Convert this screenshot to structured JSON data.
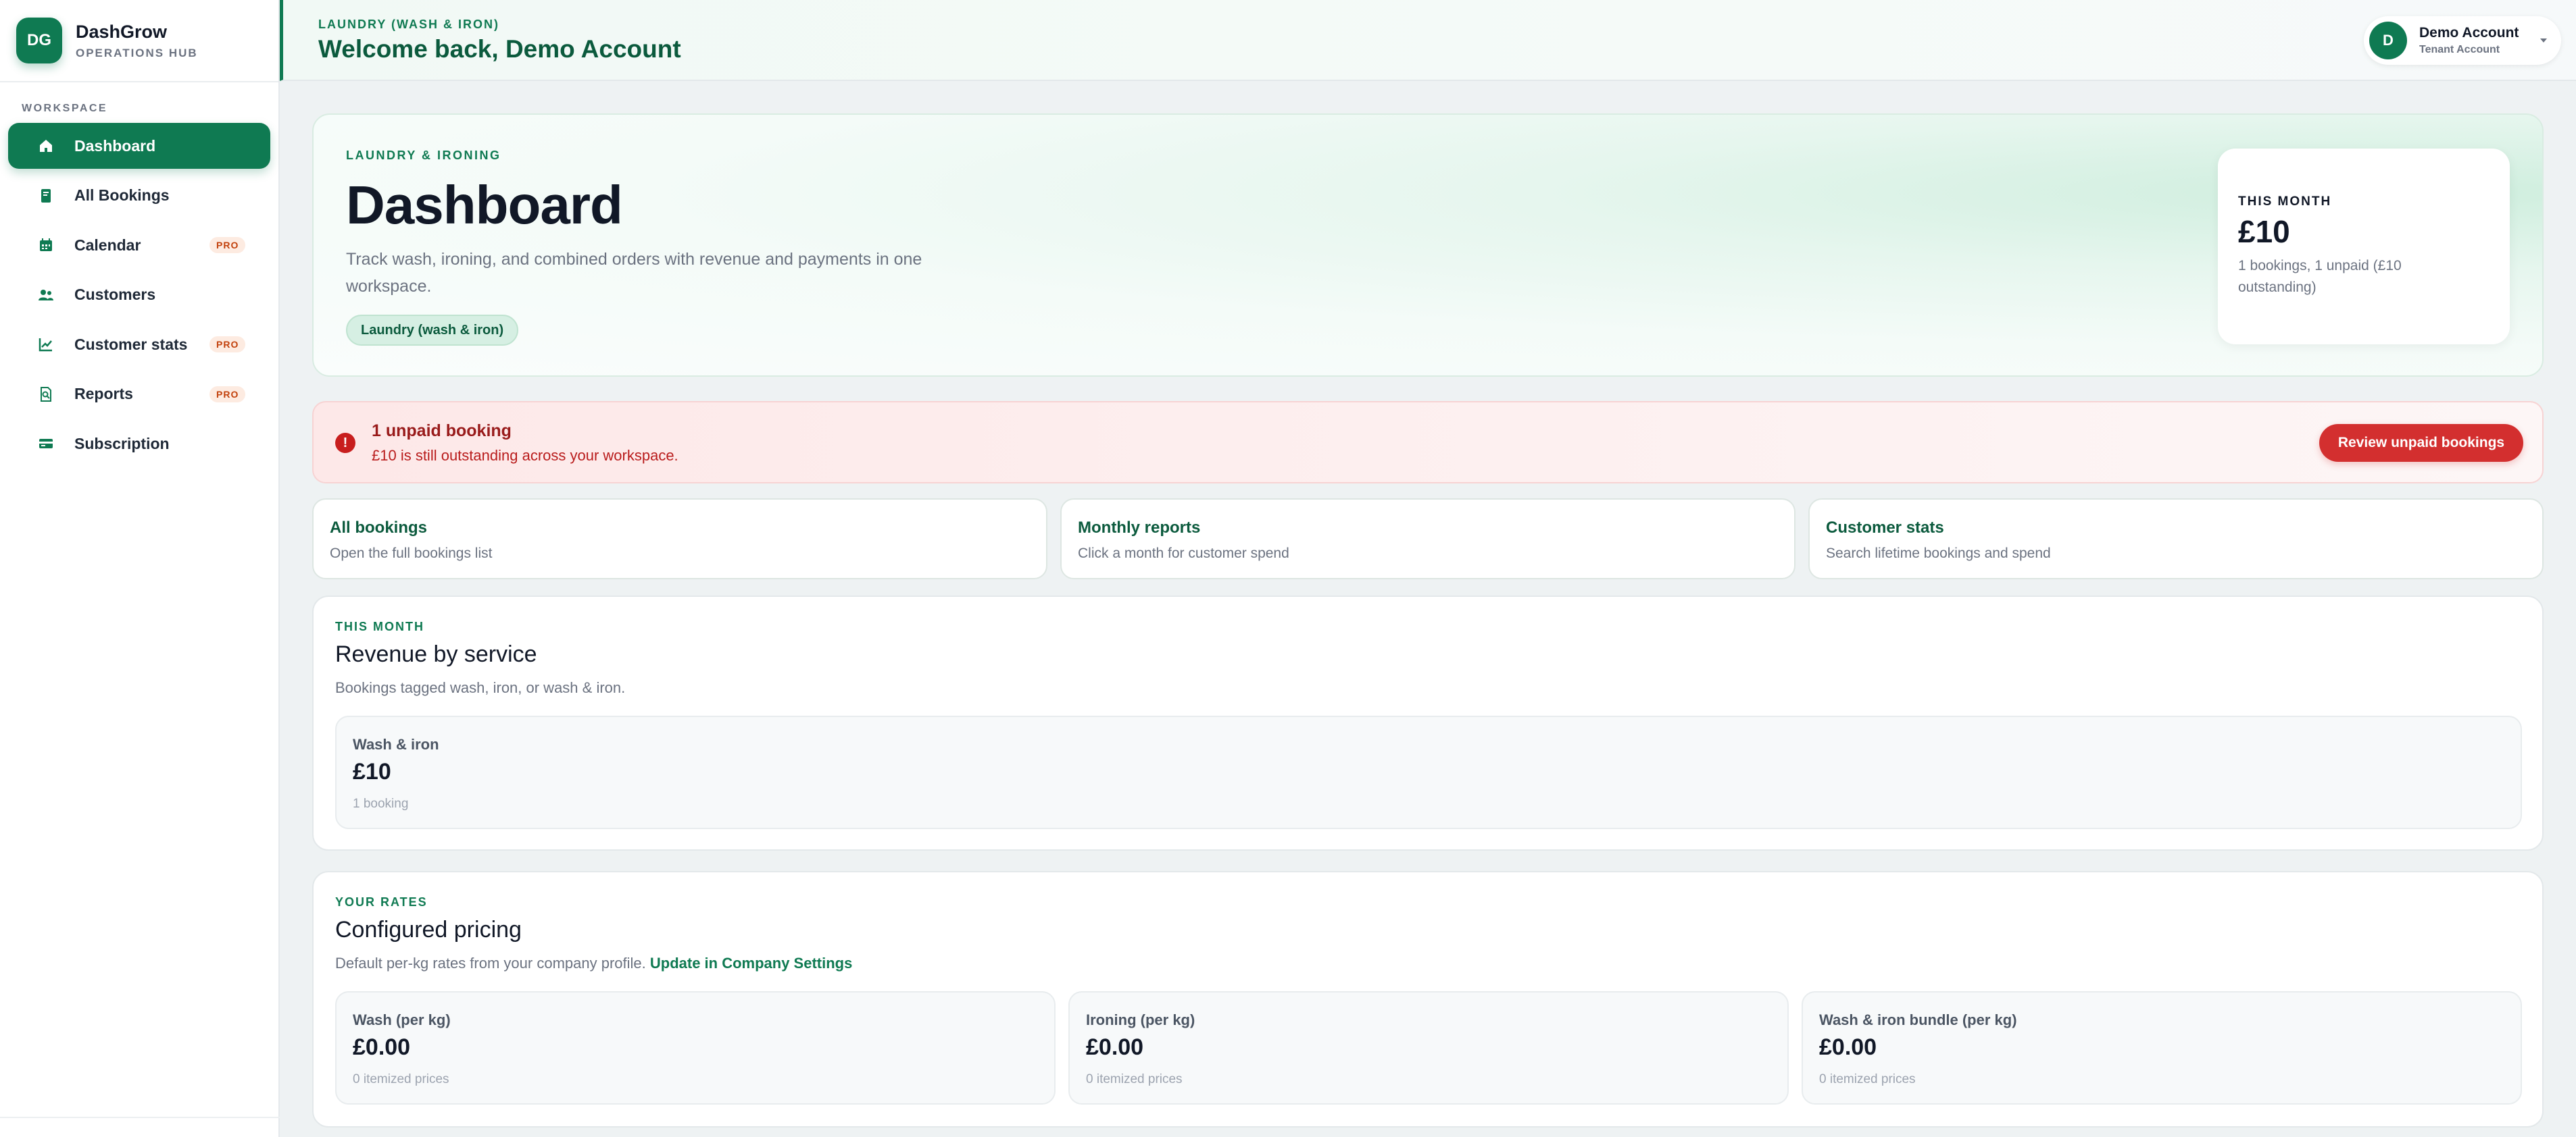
{
  "brand": {
    "logo": "DG",
    "name": "DashGrow",
    "subtitle": "OPERATIONS HUB"
  },
  "sidebar": {
    "section_label": "WORKSPACE",
    "items": [
      {
        "label": "Dashboard",
        "icon": "home-icon",
        "active": true,
        "badge": ""
      },
      {
        "label": "All Bookings",
        "icon": "book-icon",
        "active": false,
        "badge": ""
      },
      {
        "label": "Calendar",
        "icon": "calendar-icon",
        "active": false,
        "badge": "PRO"
      },
      {
        "label": "Customers",
        "icon": "users-icon",
        "active": false,
        "badge": ""
      },
      {
        "label": "Customer stats",
        "icon": "chart-line-icon",
        "active": false,
        "badge": "PRO"
      },
      {
        "label": "Reports",
        "icon": "report-search-icon",
        "active": false,
        "badge": "PRO"
      },
      {
        "label": "Subscription",
        "icon": "credit-card-icon",
        "active": false,
        "badge": ""
      }
    ]
  },
  "header": {
    "kicker": "LAUNDRY (WASH & IRON)",
    "title": "Welcome back, Demo Account",
    "account": {
      "avatar": "D",
      "name": "Demo Account",
      "role": "Tenant Account"
    }
  },
  "hero": {
    "kicker": "LAUNDRY & IRONING",
    "title": "Dashboard",
    "description": "Track wash, ironing, and combined orders with revenue and payments in one workspace.",
    "tag": "Laundry (wash & iron)",
    "month": {
      "kicker": "THIS MONTH",
      "value": "£10",
      "description": "1 bookings, 1 unpaid (£10 outstanding)"
    }
  },
  "alert": {
    "icon": "!",
    "title": "1 unpaid booking",
    "description": "£10 is still outstanding across your workspace.",
    "button": "Review unpaid bookings"
  },
  "quick_links": [
    {
      "title": "All bookings",
      "description": "Open the full bookings list"
    },
    {
      "title": "Monthly reports",
      "description": "Click a month for customer spend"
    },
    {
      "title": "Customer stats",
      "description": "Search lifetime bookings and spend"
    }
  ],
  "revenue": {
    "kicker": "THIS MONTH",
    "title": "Revenue by service",
    "description": "Bookings tagged wash, iron, or wash & iron.",
    "items": [
      {
        "label": "Wash & iron",
        "value": "£10",
        "sub": "1 booking"
      }
    ]
  },
  "pricing": {
    "kicker": "YOUR RATES",
    "title": "Configured pricing",
    "description": "Default per-kg rates from your company profile.",
    "link": "Update in Company Settings",
    "items": [
      {
        "label": "Wash (per kg)",
        "value": "£0.00",
        "sub": "0 itemized prices"
      },
      {
        "label": "Ironing (per kg)",
        "value": "£0.00",
        "sub": "0 itemized prices"
      },
      {
        "label": "Wash & iron bundle (per kg)",
        "value": "£0.00",
        "sub": "0 itemized prices"
      }
    ]
  },
  "colors": {
    "brand": "#0f7a52",
    "danger": "#d32f2f",
    "pro_badge": "#c2410c"
  }
}
